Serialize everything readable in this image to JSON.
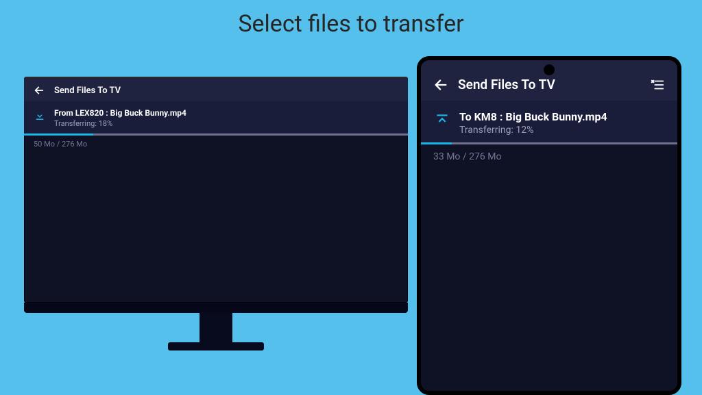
{
  "page_title": "Select files to transfer",
  "accent_color": "#19b7e6",
  "tv": {
    "header_title": "Send Files To TV",
    "item_title": "From LEX820 : Big Buck Bunny.mp4",
    "item_status": "Transferring: 18%",
    "progress_pct": 18,
    "bytes_text": "50 Mo / 276 Mo"
  },
  "phone": {
    "header_title": "Send Files To TV",
    "item_title": "To KM8 : Big Buck Bunny.mp4",
    "item_status": "Transferring: 12%",
    "progress_pct": 12,
    "bytes_text": "33 Mo / 276 Mo"
  }
}
